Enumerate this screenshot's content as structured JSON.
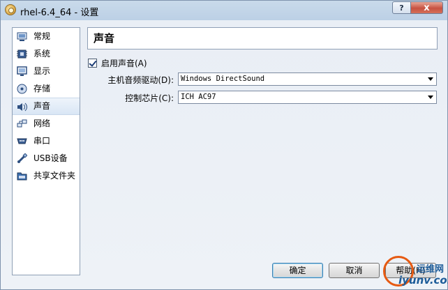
{
  "window": {
    "title": "rhel-6.4_64 - 设置",
    "help_label": "?",
    "close_label": "x"
  },
  "sidebar": {
    "items": [
      {
        "label": "常规",
        "icon": "general-icon"
      },
      {
        "label": "系统",
        "icon": "system-chip-icon"
      },
      {
        "label": "显示",
        "icon": "display-monitor-icon"
      },
      {
        "label": "存储",
        "icon": "storage-disk-icon"
      },
      {
        "label": "声音",
        "icon": "speaker-icon"
      },
      {
        "label": "网络",
        "icon": "network-icon"
      },
      {
        "label": "串口",
        "icon": "serial-port-icon"
      },
      {
        "label": "USB设备",
        "icon": "usb-icon"
      },
      {
        "label": "共享文件夹",
        "icon": "shared-folder-icon"
      }
    ],
    "selected_index": 4
  },
  "audio": {
    "section_title": "声音",
    "enable_label": "启用声音(A)",
    "enabled": true,
    "host_driver_label": "主机音频驱动(D):",
    "host_driver_value": "Windows DirectSound",
    "controller_label": "控制芯片(C):",
    "controller_value": "ICH AC97"
  },
  "buttons": {
    "ok": "确定",
    "cancel": "取消",
    "help": "帮助(H)"
  },
  "watermark": {
    "line1": "运维网",
    "line2": "iyunv.com"
  },
  "colors": {
    "accent": "#3c7fb1",
    "close_red": "#c75241",
    "watermark_orange": "#e65a12",
    "watermark_blue": "#1d5c99"
  }
}
